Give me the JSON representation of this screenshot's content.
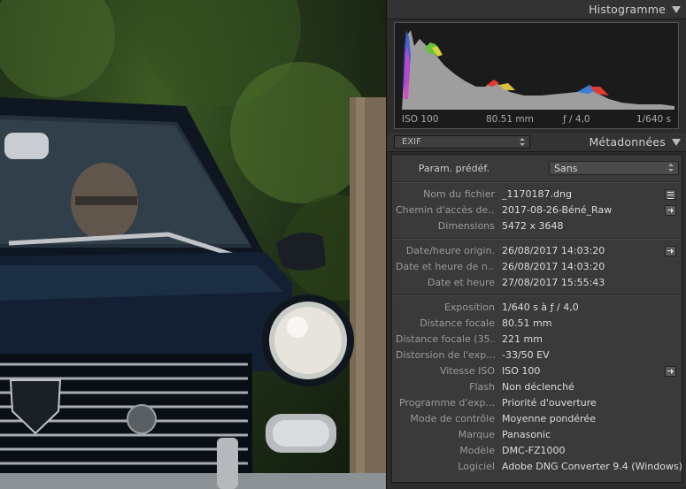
{
  "photo": {
    "subject": "car-photo"
  },
  "histogram": {
    "title": "Histogramme",
    "iso": "ISO 100",
    "focal": "80.51 mm",
    "aperture": "ƒ / 4,0",
    "speed": "1/640 s"
  },
  "metadata": {
    "title": "Métadonnées",
    "preset_select": "EXIF",
    "preset_label": "Param. prédéf.",
    "preset_value": "Sans",
    "groups": [
      [
        {
          "label": "Nom du fichier",
          "value": "_1170187.dng",
          "button": "list-icon"
        },
        {
          "label": "Chemin d'accès de...",
          "value": "2017-08-26-Béné_Raw",
          "button": "arrow-icon"
        },
        {
          "label": "Dimensions",
          "value": "5472 x 3648",
          "button": ""
        }
      ],
      [
        {
          "label": "Date/heure origin.",
          "value": "26/08/2017 14:03:20",
          "button": "arrow-icon"
        },
        {
          "label": "Date et heure de n...",
          "value": "26/08/2017 14:03:20",
          "button": ""
        },
        {
          "label": "Date et heure",
          "value": "27/08/2017 15:55:43",
          "button": ""
        }
      ],
      [
        {
          "label": "Exposition",
          "value": "1/640 s à ƒ / 4,0",
          "button": ""
        },
        {
          "label": "Distance focale",
          "value": "80.51 mm",
          "button": ""
        },
        {
          "label": "Distance focale (35...",
          "value": "221 mm",
          "button": ""
        },
        {
          "label": "Distorsion de l'exp...",
          "value": "-33/50 EV",
          "button": ""
        },
        {
          "label": "Vitesse ISO",
          "value": "ISO 100",
          "button": "arrow-icon"
        },
        {
          "label": "Flash",
          "value": "Non déclenché",
          "button": ""
        },
        {
          "label": "Programme d'exp...",
          "value": "Priorité d'ouverture",
          "button": ""
        },
        {
          "label": "Mode de contrôle",
          "value": "Moyenne pondérée",
          "button": ""
        },
        {
          "label": "Marque",
          "value": "Panasonic",
          "button": ""
        },
        {
          "label": "Modèle",
          "value": "DMC-FZ1000",
          "button": ""
        },
        {
          "label": "Logiciel",
          "value": "Adobe DNG Converter 9.4 (Windows)",
          "button": ""
        }
      ]
    ]
  },
  "colors": {
    "panel_bg": "#2c2c2c",
    "field_bg": "#3a3a3a",
    "label": "#9a9a9a",
    "value": "#dcdcdc",
    "hist_gray": "#9e9e9e"
  }
}
